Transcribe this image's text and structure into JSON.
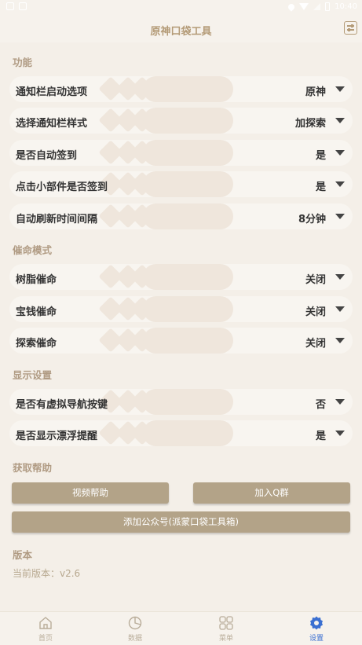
{
  "statusbar": {
    "time": "10:40"
  },
  "header": {
    "title": "原神口袋工具"
  },
  "sections": [
    {
      "title": "功能",
      "rows": [
        {
          "label": "通知栏启动选项",
          "value": "原神"
        },
        {
          "label": "选择通知栏样式",
          "value": "加探索"
        },
        {
          "label": "是否自动签到",
          "value": "是"
        },
        {
          "label": "点击小部件是否签到",
          "value": "是"
        },
        {
          "label": "自动刷新时间间隔",
          "value": "8分钟"
        }
      ]
    },
    {
      "title": "催命模式",
      "rows": [
        {
          "label": "树脂催命",
          "value": "关闭"
        },
        {
          "label": "宝钱催命",
          "value": "关闭"
        },
        {
          "label": "探索催命",
          "value": "关闭"
        }
      ]
    },
    {
      "title": "显示设置",
      "rows": [
        {
          "label": "是否有虚拟导航按键",
          "value": "否"
        },
        {
          "label": "是否显示漂浮提醒",
          "value": "是"
        }
      ]
    },
    {
      "title": "获取帮助"
    }
  ],
  "help": {
    "video_help": "视频帮助",
    "join_group": "加入Q群",
    "add_account": "添加公众号(派蒙口袋工具箱)"
  },
  "version": {
    "title": "版本",
    "text": "当前版本：v2.6"
  },
  "nav": [
    {
      "label": "首页",
      "icon": "home-icon",
      "active": false
    },
    {
      "label": "数据",
      "icon": "pie-chart-icon",
      "active": false
    },
    {
      "label": "菜单",
      "icon": "grid-icon",
      "active": false
    },
    {
      "label": "设置",
      "icon": "gear-icon",
      "active": true
    }
  ],
  "colors": {
    "accent": "#b49b77",
    "button": "#b3a388",
    "nav_active": "#3a6fd1"
  }
}
